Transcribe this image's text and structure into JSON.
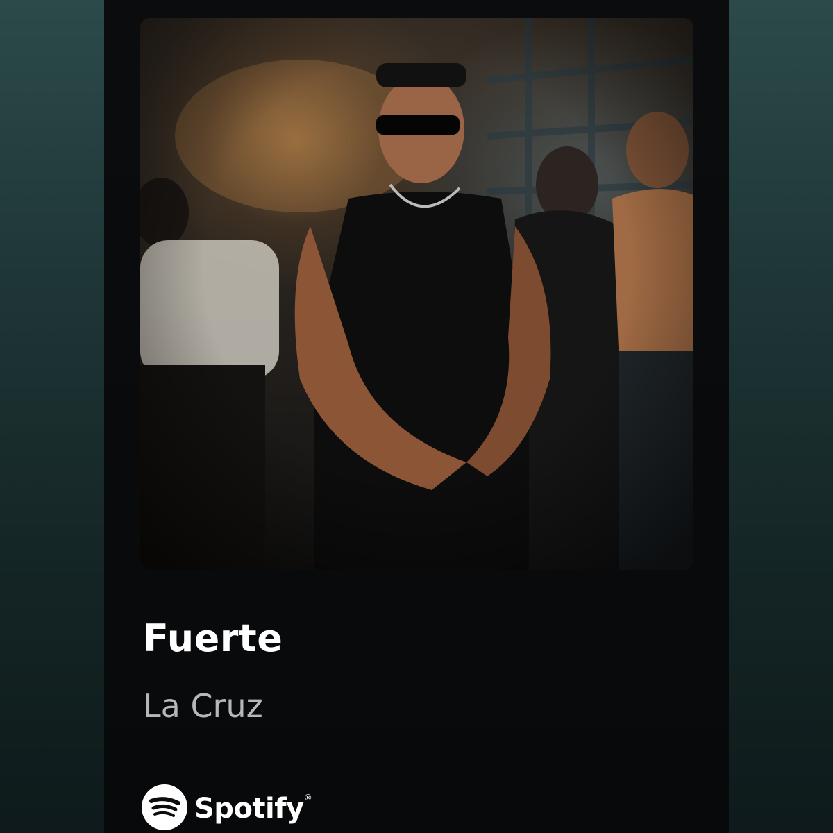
{
  "track": {
    "title": "Fuerte",
    "artist": "La Cruz",
    "cover_description": ""
  },
  "brand": {
    "name": "Spotify",
    "icon": "spotify-logo-icon",
    "color": "#ffffff"
  },
  "colors": {
    "background_top": "#2c4a4a",
    "background_bottom": "#0e1a1b",
    "card": "#0a0c0e",
    "title": "#ffffff",
    "artist": "#b7b7b7"
  }
}
